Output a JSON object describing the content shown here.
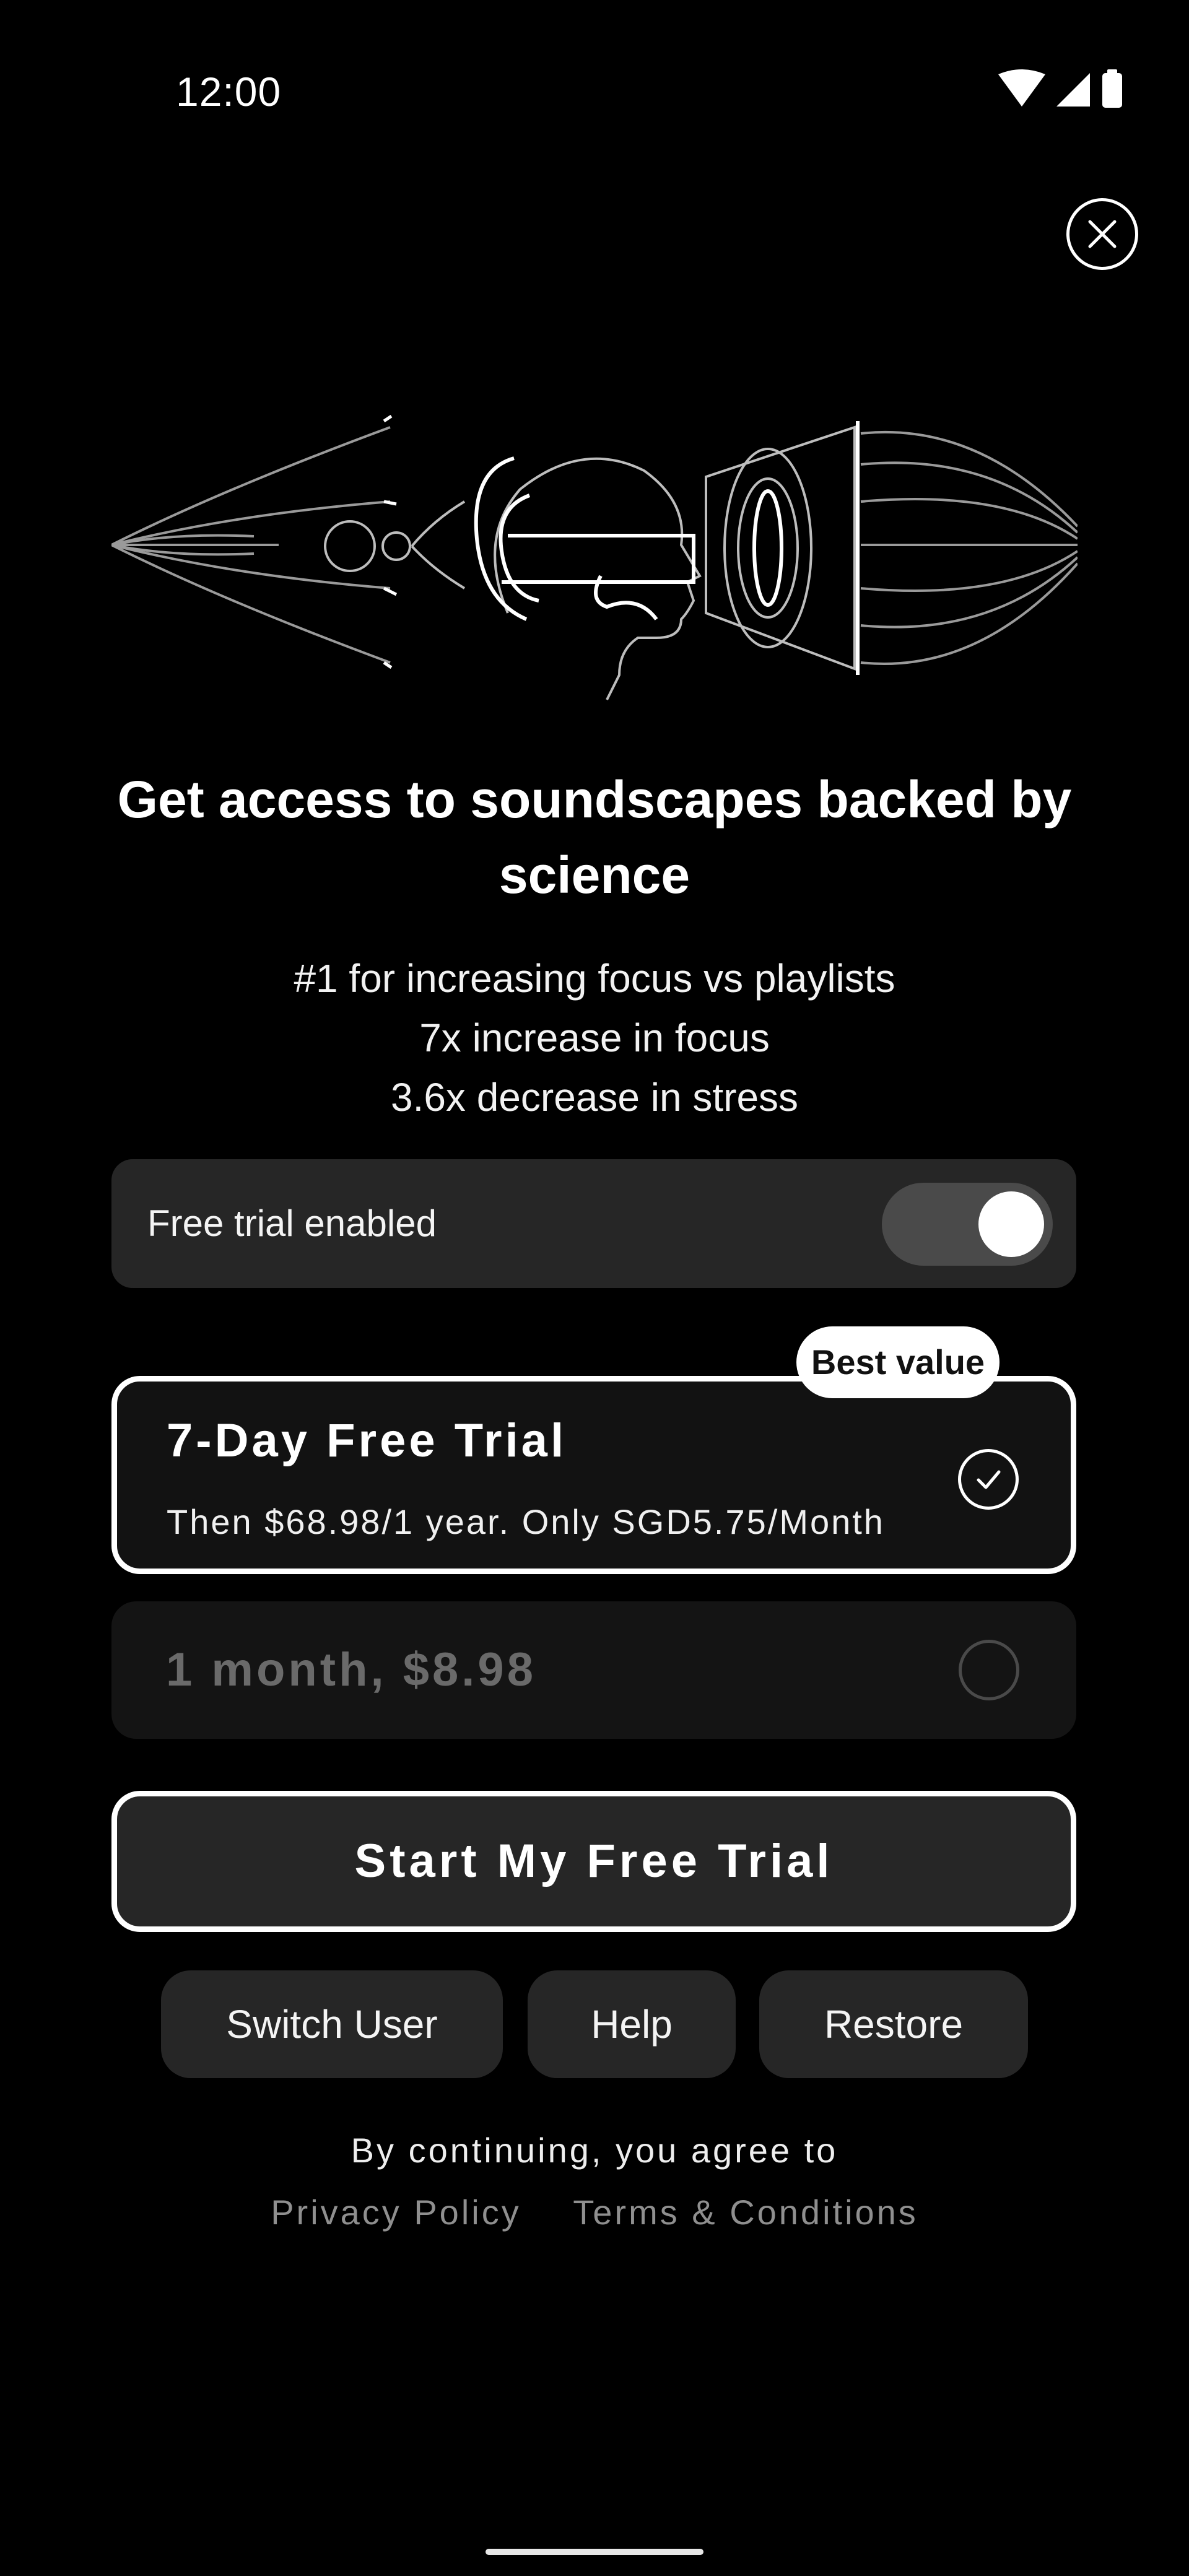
{
  "status_bar": {
    "time": "12:00",
    "icons": [
      "wifi-icon",
      "signal-icon",
      "battery-icon"
    ]
  },
  "close_icon": "close-icon",
  "hero_icon": "soundscape-illustration",
  "headline": "Get access to soundscapes backed by science",
  "benefits": [
    "#1 for increasing focus vs playlists",
    "7x increase in focus",
    "3.6x decrease in stress"
  ],
  "free_trial_toggle": {
    "label": "Free trial enabled",
    "enabled": true
  },
  "plans": {
    "badge": "Best value",
    "yearly": {
      "title": "7-Day Free Trial",
      "subtitle": "Then $68.98/1 year. Only SGD5.75/Month",
      "selected": true
    },
    "monthly": {
      "title": "1 month, $8.98",
      "selected": false
    }
  },
  "cta": {
    "label": "Start My Free Trial"
  },
  "secondary_actions": {
    "switch_user": "Switch User",
    "help": "Help",
    "restore": "Restore"
  },
  "legal": {
    "intro": "By continuing, you agree to",
    "privacy": "Privacy Policy",
    "terms": "Terms & Conditions"
  },
  "colors": {
    "background": "#000000",
    "card": "#262626",
    "accent": "#ffffff",
    "muted_text": "#8f8f8f"
  }
}
